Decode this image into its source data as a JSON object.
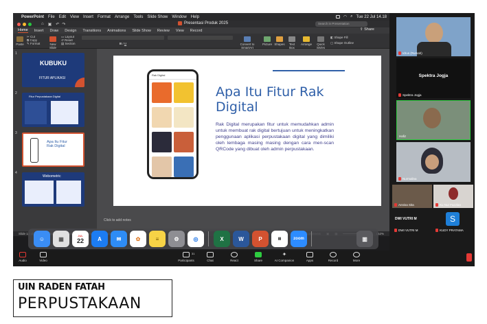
{
  "menubar": {
    "app_name": "PowerPoint",
    "items": [
      "File",
      "Edit",
      "View",
      "Insert",
      "Format",
      "Arrange",
      "Tools",
      "Slide Show",
      "Window",
      "Help"
    ],
    "clock": "Tue 22 Jul 14.18"
  },
  "window": {
    "doc_title": "Presentasi Produk 2025",
    "search_placeholder": "Search in Presentation",
    "share_label": "Share"
  },
  "ribbon_tabs": [
    "Home",
    "Insert",
    "Draw",
    "Design",
    "Transitions",
    "Animations",
    "Slide Show",
    "Review",
    "View",
    "Record"
  ],
  "ribbon": {
    "paste": "Paste",
    "cut": "Cut",
    "copy": "Copy",
    "format": "Format",
    "new_slide": "New Slide",
    "layout": "Layout",
    "reset": "Reset",
    "section": "Section",
    "convert": "Convert to SmartArt",
    "picture": "Picture",
    "shapes": "Shapes",
    "textbox": "Text Box",
    "arrange": "Arrange",
    "quick_styles": "Quick Styles",
    "shape_fill": "Shape Fill",
    "shape_outline": "Shape Outline"
  },
  "thumbnails": [
    {
      "num": "1",
      "title": "KUBUKU",
      "subtitle": "FITUR APLIKASI"
    },
    {
      "num": "2",
      "title": "Fitur Perpustakaan Digital"
    },
    {
      "num": "3",
      "title": "Apa Itu Fitur Rak Digital"
    },
    {
      "num": "4",
      "title": "Webometric"
    }
  ],
  "slide": {
    "title": "Apa Itu Fitur Rak Digital",
    "body": "Rak Digital merupakan fitur untuk memudahkan admin untuk membuat rak digital bertujuan untuk meningkatkan penggunaan aplikasi perpustakaan digital yang dimiliki oleh lembaga masing masing dengan cara men-scan QRCode yang dibuat oleh admin perpustakaan.",
    "phone_header": "Rak Digital"
  },
  "notes_placeholder": "Click to add notes",
  "statusbar": {
    "slide_of": "Slide 14 of 59",
    "language": "English (United States)",
    "accessibility": "Accessibility: Investigate",
    "notes": "Notes",
    "comments": "Comments",
    "zoom": "152%"
  },
  "participants": [
    {
      "name": "Idrus (Rumah)"
    },
    {
      "name": "Spektra Jogja",
      "label": "Spektra Jogja"
    },
    {
      "name": "Hafiz"
    },
    {
      "name": "Nurmalina"
    },
    {
      "name": "Annisa Sita"
    },
    {
      "name": "Ku Nur Fazzlan"
    },
    {
      "name": "DWI VUTRI M",
      "initial": "S"
    },
    {
      "name": "KUDY PRATAMA"
    }
  ],
  "zoom_toolbar": [
    "Audio",
    "Video",
    "Participants",
    "Chat",
    "React",
    "Share",
    "AI Companion",
    "Apps",
    "Record",
    "More"
  ],
  "participants_count": "31",
  "dock_calendar_day": "22",
  "dock_calendar_month": "JUL",
  "logo": {
    "line1": "UIN RADEN FATAH",
    "line2": "PERPUSTAKAAN"
  }
}
